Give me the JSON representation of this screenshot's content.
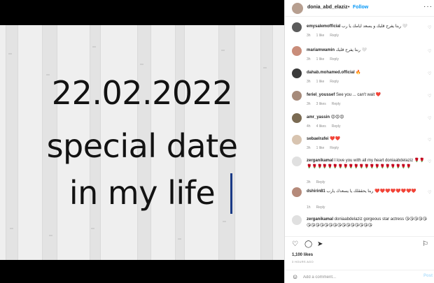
{
  "post": {
    "lines": [
      "22.02.2022",
      "special date",
      "in my life"
    ]
  },
  "header": {
    "username": "donia_abd_elaziz",
    "separator": "•",
    "follow_label": "Follow",
    "more_icon": "more-icon"
  },
  "comments": [
    {
      "user": "emysalemofficial",
      "text": "ربنا يفرح قلبك و يسعد ايامك يا رب 🤍",
      "time": "3h",
      "likes": "1 like",
      "reply": "Reply"
    },
    {
      "user": "mariamwamin",
      "text": "ربنا يفرح قلبك 🤍",
      "time": "3h",
      "likes": "1 like",
      "reply": "Reply"
    },
    {
      "user": "dahab.mohamed.official",
      "text": "🔥",
      "time": "3h",
      "likes": "1 like",
      "reply": "Reply"
    },
    {
      "user": "feriel_youssef",
      "text": "See you ... can't wait ❤️",
      "time": "3h",
      "likes": "3 likes",
      "reply": "Reply"
    },
    {
      "user": "amr_yassin",
      "text": "😍😍😍",
      "time": "4h",
      "likes": "4 likes",
      "reply": "Reply"
    },
    {
      "user": "sebaelrafei",
      "text": "❤️❤️",
      "time": "3h",
      "likes": "1 like",
      "reply": "Reply"
    },
    {
      "user": "zerganikamal",
      "text": "I love you with all my heart doniaabdelaziz 🌹🌹🌹🌹🌹🌹🌹🌹🌹🌹🌹🌹🌹🌹🌹🌹🌹🌹🌹🌹🌹🌹",
      "time": "3h",
      "likes": "",
      "reply": "Reply"
    },
    {
      "user": "dshirin81",
      "text": "ربنا يحققلك يا يسعدك يارب ❤️❤️❤️❤️❤️❤️❤️❤️",
      "time": "1h",
      "likes": "",
      "reply": "Reply"
    },
    {
      "user": "zerganikamal",
      "text": "doniaabdelaziz gorgeous star actress 😘😘😘😘😘😘😘😘😘😘😘😘😘😘😘😘😘😘😘😘",
      "time": "",
      "likes": "",
      "reply": ""
    }
  ],
  "actions": {
    "likes": "1,100 likes",
    "timestamp": "3 HOURS AGO"
  },
  "add_comment": {
    "placeholder": "Add a comment...",
    "post_label": "Post"
  },
  "colors": {
    "accent": "#0095f6",
    "text": "#262626",
    "muted": "#8e8e8e",
    "caret": "#1a3a86"
  }
}
